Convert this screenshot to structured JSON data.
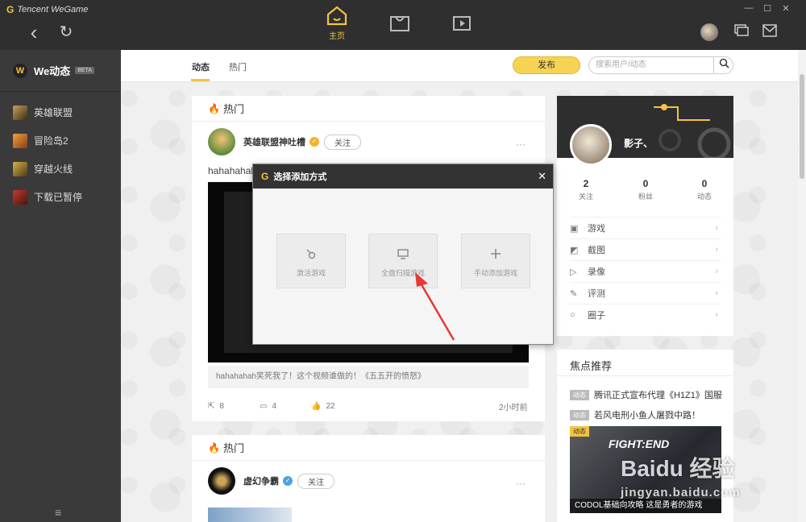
{
  "app": {
    "logo_g": "G",
    "logo_text": "Tencent WeGame"
  },
  "window_controls": {
    "minimize": "—",
    "restore": "☐",
    "close": "✕"
  },
  "nav": {
    "back": "‹",
    "refresh": "↻"
  },
  "main_tabs": {
    "home_label": "主页"
  },
  "sidebar": {
    "header": "We动态",
    "beta": "BETA",
    "items": [
      {
        "label": "英雄联盟"
      },
      {
        "label": "冒险岛2"
      },
      {
        "label": "穿越火线"
      },
      {
        "label": "下载已暂停"
      }
    ],
    "bottom_icon": "≡"
  },
  "topbar": {
    "tab_active": "动态",
    "tab_other": "热门",
    "publish": "发布",
    "search_placeholder": "搜索用户/动态",
    "search_icon": "search-icon"
  },
  "feed": {
    "section_title": "热门",
    "post1": {
      "author": "英雄联盟神吐槽",
      "follow": "关注",
      "text": "hahahahah",
      "quote": "hahahahah笑死我了！这个视频谁做的！《五五开的愤怒》",
      "shares": "8",
      "comments": "4",
      "likes": "22",
      "time": "2小时前",
      "more": "···"
    },
    "section_title2": "热门",
    "post2": {
      "author": "虚幻争霸",
      "follow": "关注",
      "more": "···"
    }
  },
  "modal": {
    "title": "选择添加方式",
    "close": "✕",
    "options": [
      {
        "label": "激活游戏",
        "icon": "activate-icon"
      },
      {
        "label": "全盘扫描游戏",
        "icon": "monitor-icon"
      },
      {
        "label": "手动添加游戏",
        "icon": "plus-icon"
      }
    ]
  },
  "profile": {
    "name": "影子、",
    "stats": [
      {
        "value": "2",
        "label": "关注"
      },
      {
        "value": "0",
        "label": "粉丝"
      },
      {
        "value": "0",
        "label": "动态"
      }
    ],
    "menu": [
      {
        "label": "游戏",
        "icon": "game-icon"
      },
      {
        "label": "截图",
        "icon": "screenshot-icon"
      },
      {
        "label": "录像",
        "icon": "video-icon"
      },
      {
        "label": "评测",
        "icon": "review-icon"
      },
      {
        "label": "圈子",
        "icon": "circle-icon"
      }
    ]
  },
  "focus": {
    "title": "焦点推荐",
    "tag": "动态",
    "news": [
      {
        "tag": "动态",
        "text": "腾讯正式宣布代理《H1Z1》国服"
      },
      {
        "tag": "动态",
        "text": "若风电刑小鱼人屠戮中路！"
      }
    ],
    "feature_tag": "动态",
    "feature_title": "FIGHT:END",
    "feature_caption": "CODOL基础向攻略 这是勇者的游戏"
  },
  "watermark": {
    "line1": "Baidu 经验",
    "line2": "jingyan.baidu.com"
  },
  "colors": {
    "accent": "#f5c242",
    "titlebar": "#2f2f2f",
    "sidebar": "#3a3a3a",
    "arrow": "#e53935"
  }
}
